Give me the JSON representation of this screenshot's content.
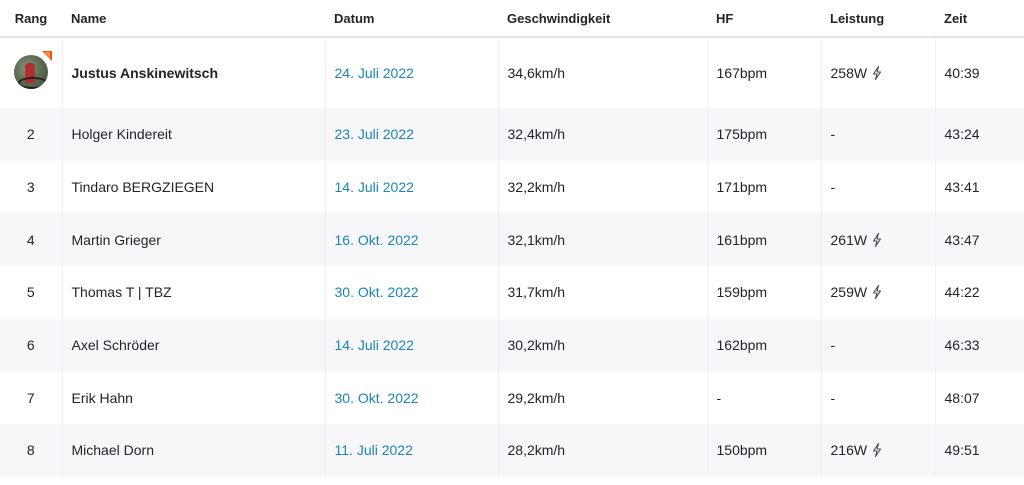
{
  "headers": {
    "rank": "Rang",
    "name": "Name",
    "date": "Datum",
    "speed": "Geschwindigkeit",
    "hr": "HF",
    "power": "Leistung",
    "time": "Zeit"
  },
  "rows": [
    {
      "rank": "",
      "name": "Justus Anskinewitsch",
      "date": "24. Juli 2022",
      "speed": "34,6km/h",
      "hr": "167bpm",
      "power": "258W",
      "time": "40:39"
    },
    {
      "rank": "2",
      "name": "Holger Kindereit",
      "date": "23. Juli 2022",
      "speed": "32,4km/h",
      "hr": "175bpm",
      "power": "-",
      "time": "43:24"
    },
    {
      "rank": "3",
      "name": "Tindaro BERGZIEGEN",
      "date": "14. Juli 2022",
      "speed": "32,2km/h",
      "hr": "171bpm",
      "power": "-",
      "time": "43:41"
    },
    {
      "rank": "4",
      "name": "Martin Grieger",
      "date": "16. Okt. 2022",
      "speed": "32,1km/h",
      "hr": "161bpm",
      "power": "261W",
      "time": "43:47"
    },
    {
      "rank": "5",
      "name": "Thomas T | TBZ",
      "date": "30. Okt. 2022",
      "speed": "31,7km/h",
      "hr": "159bpm",
      "power": "259W",
      "time": "44:22"
    },
    {
      "rank": "6",
      "name": "Axel Schröder",
      "date": "14. Juli 2022",
      "speed": "30,2km/h",
      "hr": "162bpm",
      "power": "-",
      "time": "46:33"
    },
    {
      "rank": "7",
      "name": "Erik Hahn",
      "date": "30. Okt. 2022",
      "speed": "29,2km/h",
      "hr": "-",
      "power": "-",
      "time": "48:07"
    },
    {
      "rank": "8",
      "name": "Michael Dorn",
      "date": "11. Juli 2022",
      "speed": "28,2km/h",
      "hr": "150bpm",
      "power": "216W",
      "time": "49:51"
    }
  ],
  "icons": {
    "power_measured": "lightning-bolt-icon",
    "leader_badge": "crown-icon"
  },
  "colors": {
    "date_link": "#1a86b8",
    "leader_badge": "#fc5200",
    "row_alt": "#f7f7fa"
  }
}
